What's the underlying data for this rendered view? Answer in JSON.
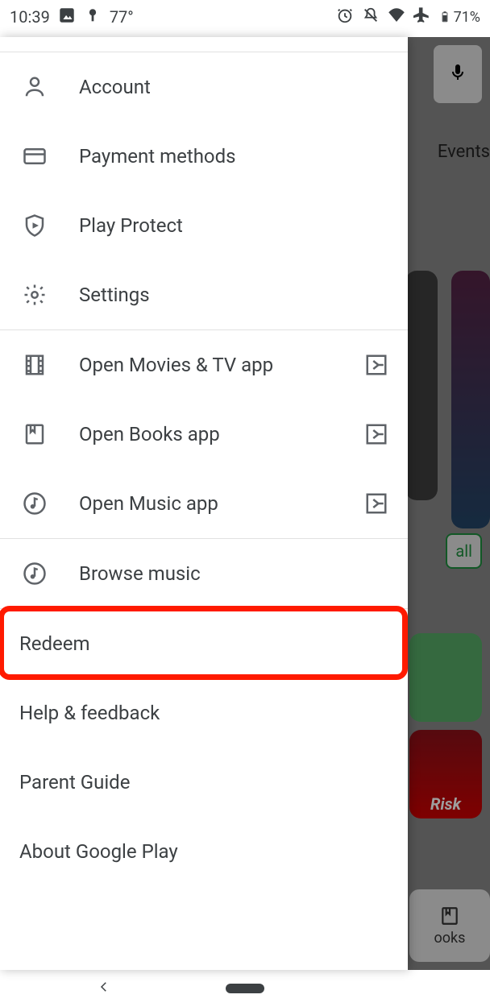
{
  "status": {
    "time": "10:39",
    "temp": "77°",
    "battery_pct": "71%"
  },
  "content": {
    "events_tab": "Events",
    "install_label": "all",
    "risk_label": "Risk",
    "books_label": "ooks"
  },
  "drawer": {
    "account": "Account",
    "payment": "Payment methods",
    "protect": "Play Protect",
    "settings": "Settings",
    "movies": "Open Movies & TV app",
    "books": "Open Books app",
    "music": "Open Music app",
    "browse_music": "Browse music",
    "redeem": "Redeem",
    "help": "Help & feedback",
    "parent": "Parent Guide",
    "about": "About Google Play"
  },
  "highlight": {
    "target": "redeem"
  }
}
